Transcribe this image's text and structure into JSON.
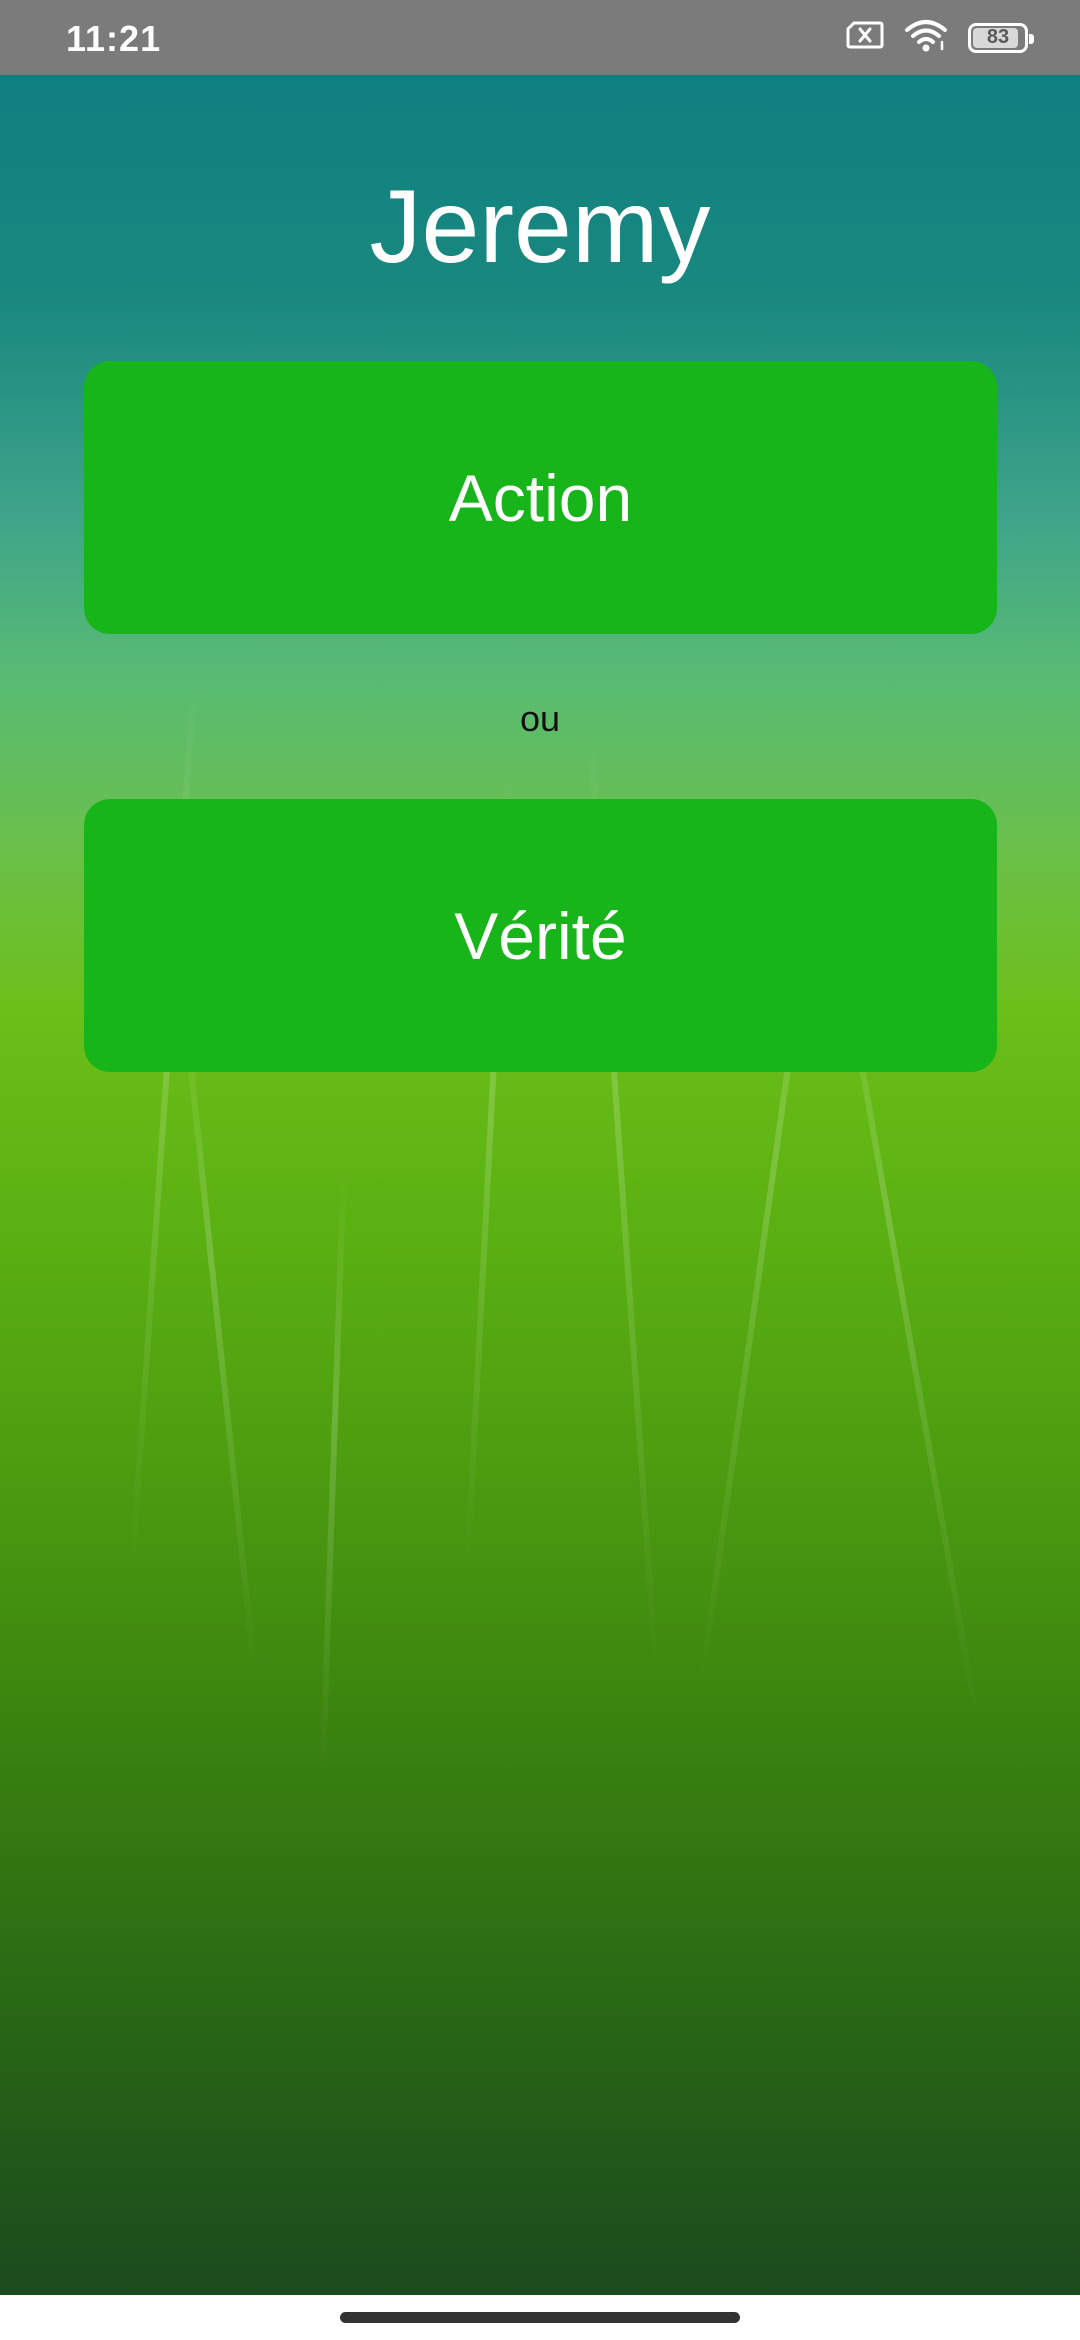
{
  "status_bar": {
    "time": "11:21",
    "battery_level": "83",
    "battery_fraction": 0.83,
    "icons": [
      "sim-card-x-icon",
      "wifi-icon",
      "battery-icon"
    ]
  },
  "game": {
    "player_name": "Jeremy",
    "action_label": "Action",
    "separator_text": "ou",
    "truth_label": "Vérité"
  },
  "colors": {
    "button_green": "#18b51a",
    "status_bar_gray": "#7b7b7b",
    "top_teal": "#0f8080",
    "bottom_dark_green": "#1b4a1e"
  }
}
